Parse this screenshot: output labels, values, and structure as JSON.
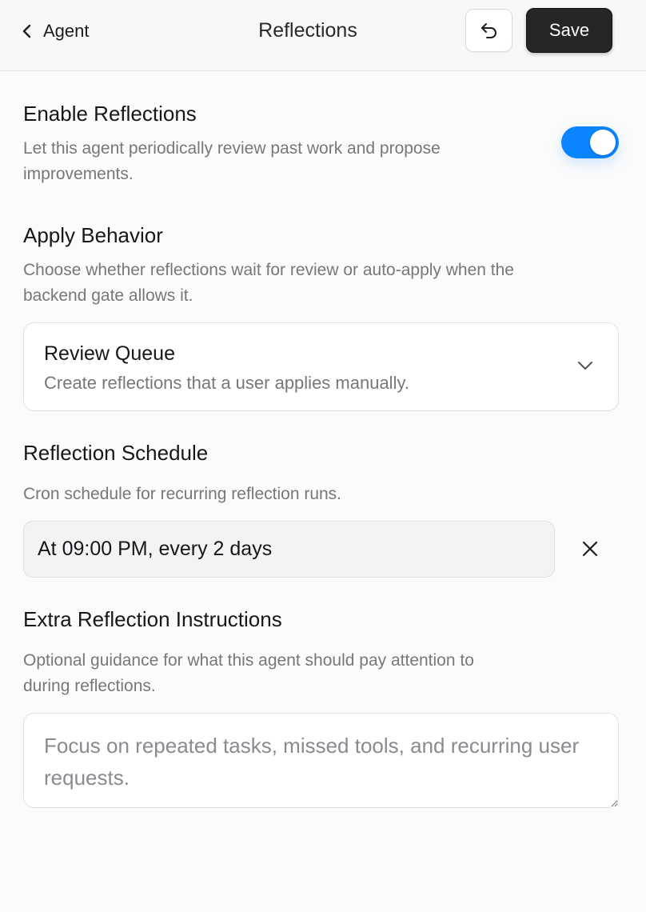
{
  "header": {
    "back_label": "Agent",
    "title": "Reflections",
    "save_label": "Save",
    "icons": {
      "back": "chevron-left-icon",
      "undo": "undo-icon"
    }
  },
  "enable": {
    "title": "Enable Reflections",
    "description_line1": "Let this agent periodically review past work and propose",
    "description_line2": "improvements.",
    "enabled": true,
    "accent_color": "#0a84ff"
  },
  "apply_behavior": {
    "title": "Apply Behavior",
    "description_line1": "Choose whether reflections wait for review or auto-apply when the",
    "description_line2": "backend gate allows it.",
    "selected_label": "Review Queue",
    "selected_description": "Create reflections that a user applies manually."
  },
  "schedule": {
    "title": "Reflection Schedule",
    "description": "Cron schedule for recurring reflection runs.",
    "value": "At 09:00 PM, every 2 days"
  },
  "instructions": {
    "title": "Extra Reflection Instructions",
    "description_line1": "Optional guidance for what this agent should pay attention to",
    "description_line2": "during reflections.",
    "placeholder": "Focus on repeated tasks, missed tools, and recurring user requests.",
    "value": ""
  }
}
